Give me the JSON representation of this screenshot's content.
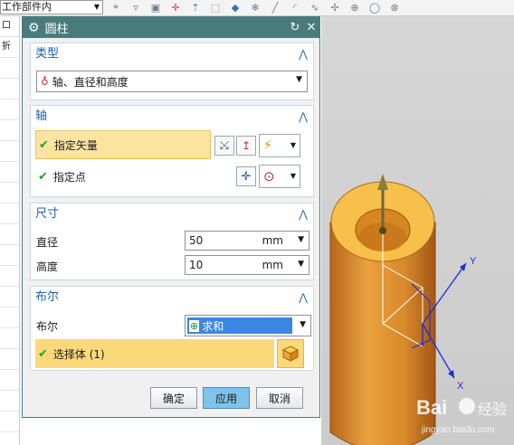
{
  "toolbar": {
    "filter_select": "工作部件内",
    "icons": [
      "snap-icon",
      "filter-icon",
      "select-icon",
      "point-icon",
      "arrow-icon",
      "box-icon",
      "cube-icon",
      "snowflake-icon",
      "line-icon",
      "arc-icon",
      "curve-icon",
      "intersect-icon",
      "tangent-icon",
      "center-icon",
      "quadrant-icon"
    ]
  },
  "leftstrip": {
    "top_label": "口",
    "second_label": "折"
  },
  "dialog": {
    "title": "圆柱",
    "reset_icon": "↻",
    "close_icon": "✕",
    "type_group": {
      "header": "类型",
      "selected": "轴、直径和高度"
    },
    "axis_group": {
      "header": "轴",
      "specify_vector": "指定矢量",
      "specify_point": "指定点"
    },
    "dimension_group": {
      "header": "尺寸",
      "diameter_label": "直径",
      "diameter_value": "50",
      "diameter_unit": "mm",
      "height_label": "高度",
      "height_value": "10",
      "height_unit": "mm"
    },
    "boolean_group": {
      "header": "布尔",
      "boolean_label": "布尔",
      "boolean_value": "求和",
      "select_body": "选择体 (1)"
    },
    "buttons": {
      "ok": "确定",
      "apply": "应用",
      "cancel": "取消"
    }
  },
  "viewport": {
    "axis_y": "Y",
    "axis_x": "X"
  },
  "watermark": {
    "brand": "Bai",
    "brand2": "经验",
    "url": "jingyan.baidu.com"
  },
  "colors": {
    "titlebar": "#4a7b7c",
    "header": "#1d5fa6",
    "highlight": "#fbd97a",
    "cylinder": "#e0922b"
  }
}
